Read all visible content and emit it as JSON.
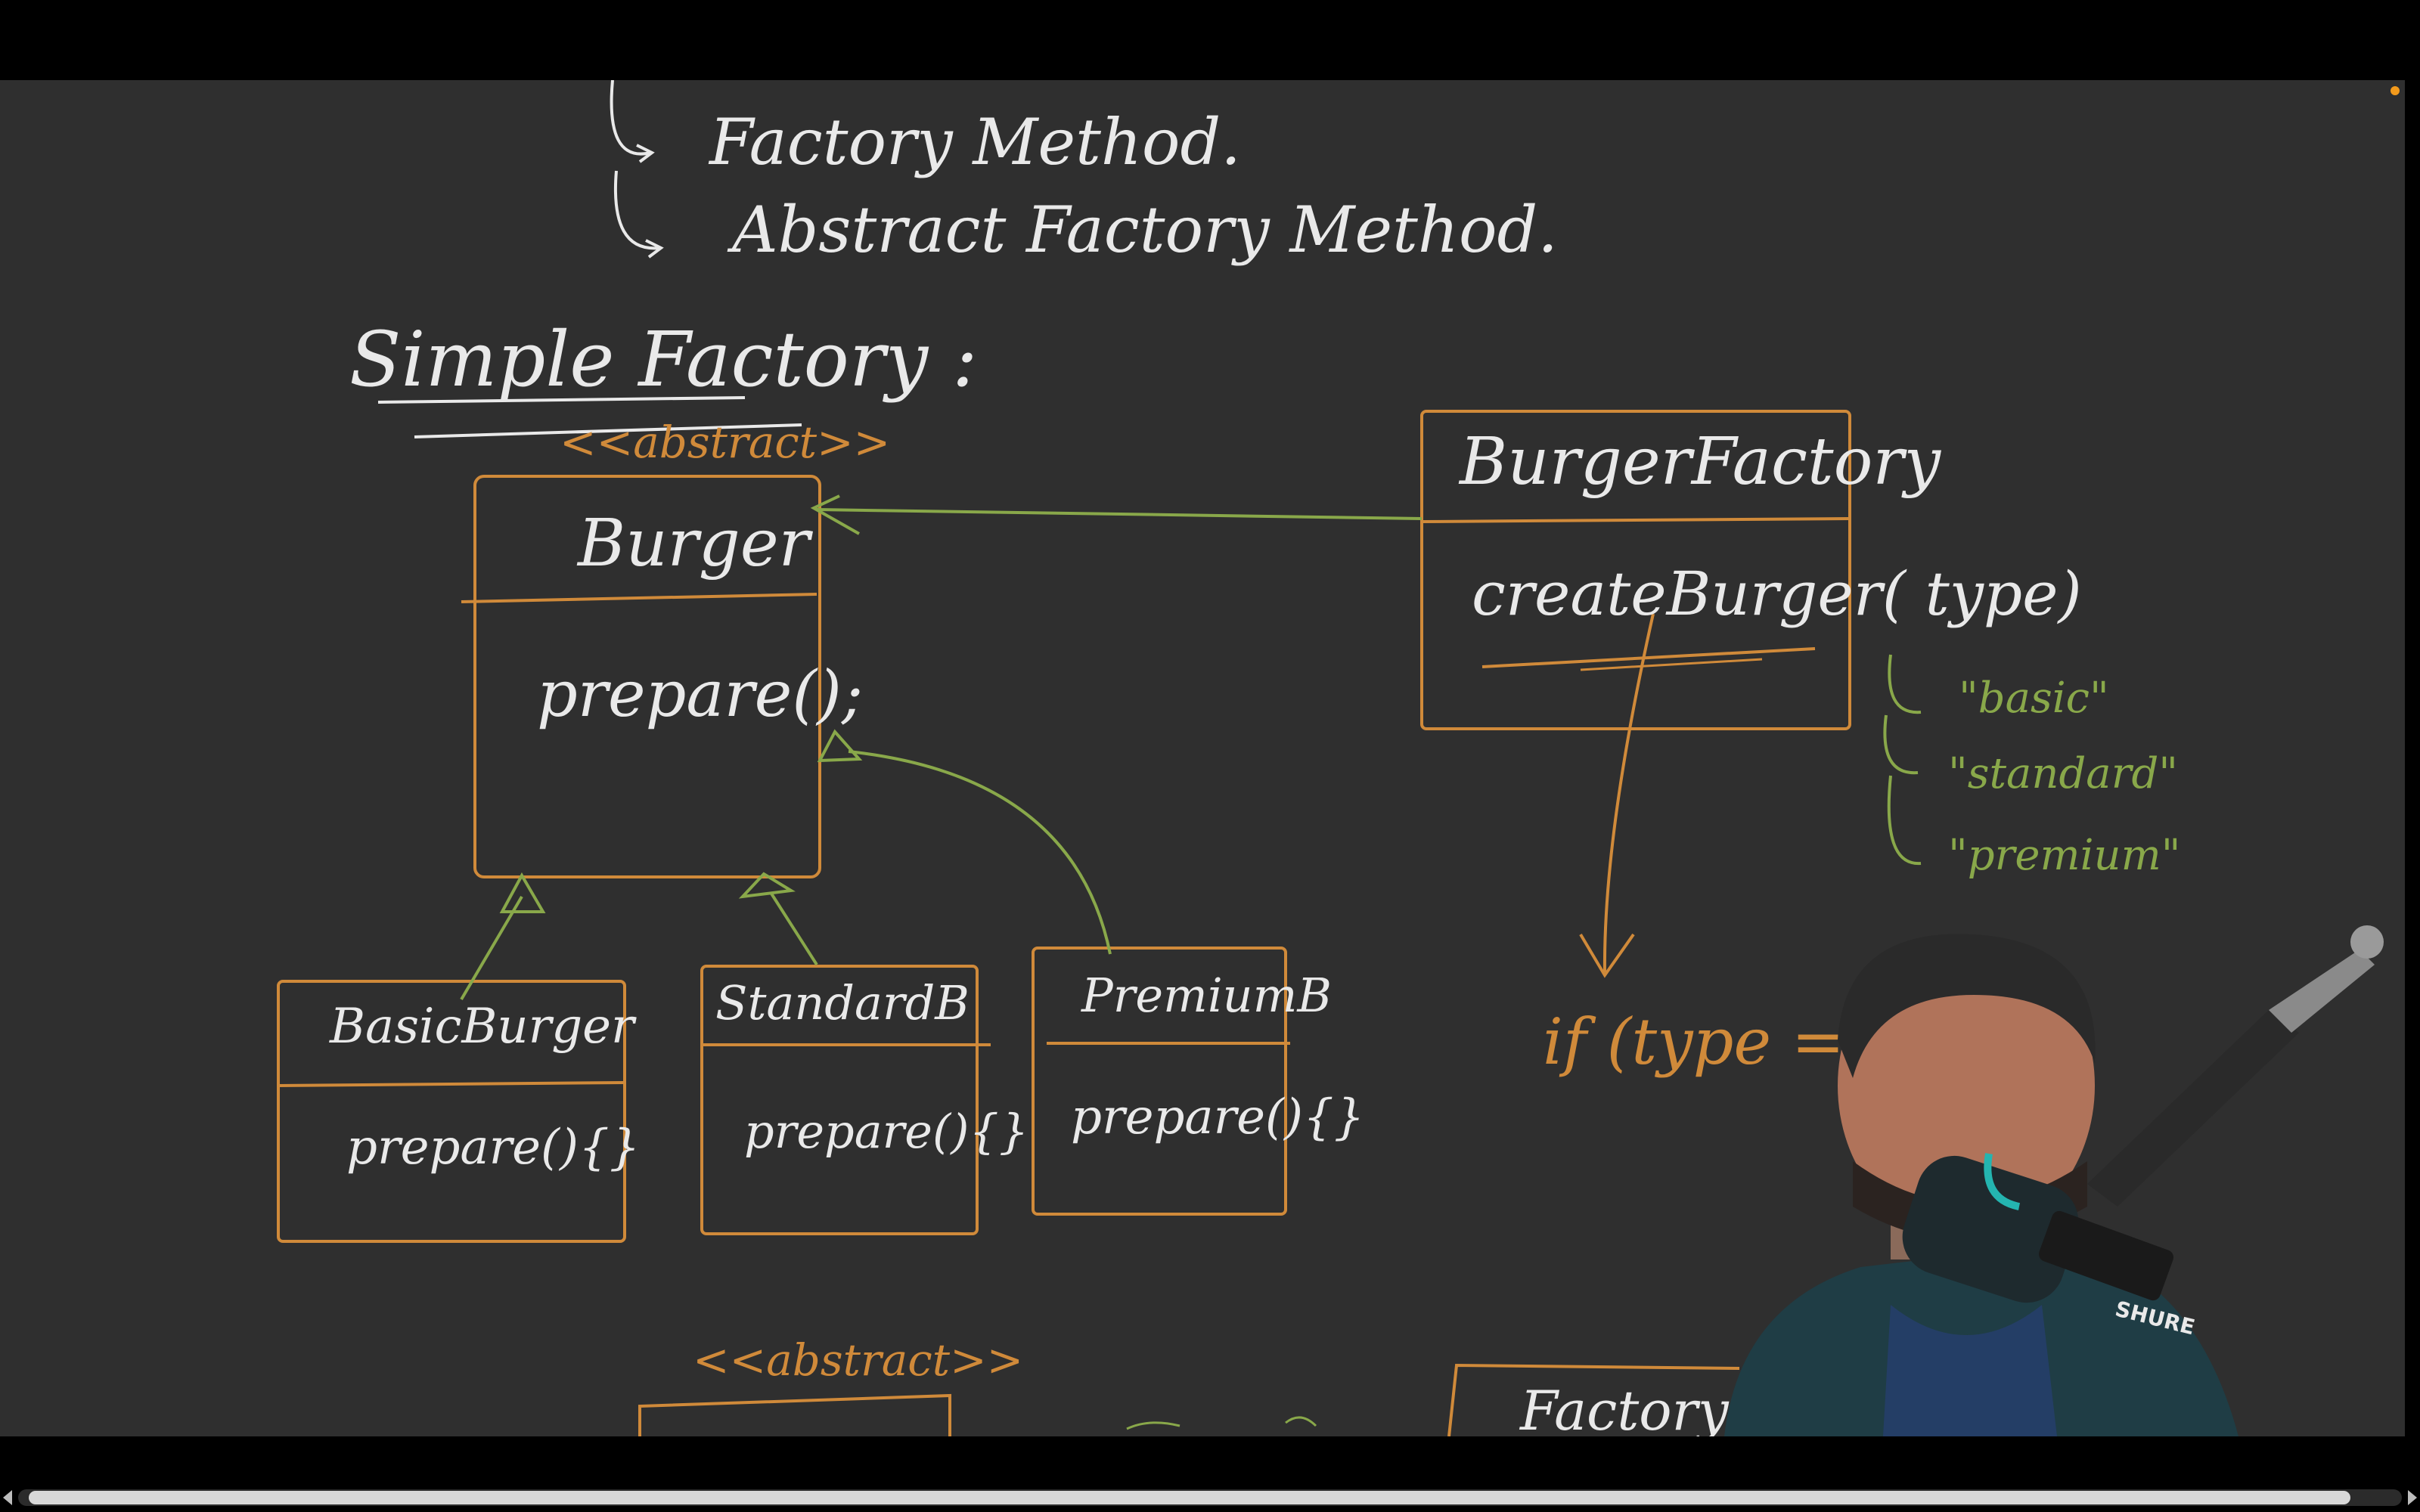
{
  "board": {
    "list_items": [
      "Factory Method.",
      "Abstract Factory Method."
    ],
    "heading": "Simple Factory :",
    "abstract_tag": "<<abstract>>",
    "burger_class": {
      "name": "Burger",
      "method": "prepare();"
    },
    "factory_class": {
      "name": "BurgerFactory",
      "method": "createBurger( type)"
    },
    "types": [
      "\"basic\"",
      "\"standard\"",
      "\"premium\""
    ],
    "subclasses": [
      {
        "name": "BasicBurger",
        "method": "prepare(){}"
      },
      {
        "name": "StandardB",
        "method": "prepare(){}"
      },
      {
        "name": "PremiumB",
        "method": "prepare(){}"
      }
    ],
    "code_snippet": "if (type == =",
    "bottom_abstract_tag": "<<abstract>>",
    "bottom_factory_label": "Factory"
  },
  "colors": {
    "canvas": "#2f2f2f",
    "chalk_white": "#e9e9e9",
    "chalk_orange": "#d08a3a",
    "chalk_green": "#89a84a"
  },
  "webcam": {
    "microphone_brand": "SHURE"
  }
}
